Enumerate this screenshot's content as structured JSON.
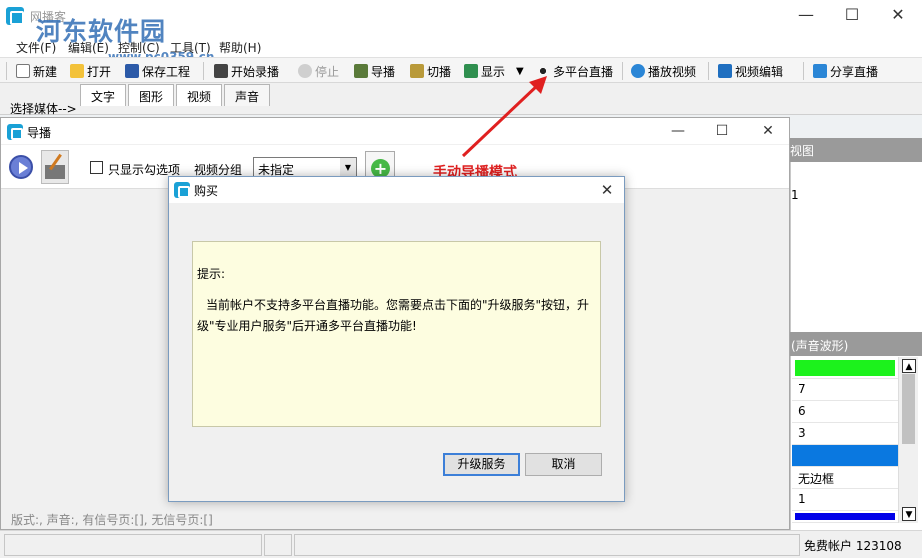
{
  "main_window": {
    "title": "网播客",
    "watermark_text": "河东软件园",
    "watermark_url": "www.pc0359.cn",
    "caption": {
      "minimize": "—",
      "maximize": "☐",
      "close": "✕"
    }
  },
  "menu": [
    "文件(F)",
    "编辑(E)",
    "控制(C)",
    "工具(T)",
    "帮助(H)"
  ],
  "toolbar": {
    "new": "新建",
    "open": "打开",
    "save": "保存工程",
    "start_record": "开始录播",
    "stop": "停止",
    "director": "导播",
    "switch": "切播",
    "display": "显示",
    "display_dropdown": "▼",
    "multi_live": "多平台直播",
    "play_video": "播放视频",
    "video_edit": "视频编辑",
    "share_live": "分享直播"
  },
  "media": {
    "select_label": "选择媒体-->",
    "tabs": [
      "文字",
      "图形",
      "视频",
      "声音"
    ]
  },
  "right_panel": {
    "header1": "视图",
    "value1": "1",
    "header2": "(声音波形)",
    "rows": [
      "",
      "7",
      "6",
      "3",
      "",
      "无边框",
      "1",
      ""
    ],
    "row_colors": {
      "green": "#1cf21c",
      "blue_sel": "#0a78e0",
      "blue_bar": "#0000e8"
    },
    "scroll_up": "▲",
    "scroll_down": "▼"
  },
  "director_window": {
    "title": "导播",
    "caption": {
      "minimize": "—",
      "maximize": "☐",
      "close": "✕"
    },
    "only_checked_label": "只显示勾选项",
    "video_group_label": "视频分组",
    "video_group_value": "未指定",
    "status_text": "版式:, 声音:, 有信号页:[], 无信号页:[]"
  },
  "annotation": {
    "text": "手动导播模式",
    "color": "#e02020"
  },
  "buy_dialog": {
    "title": "购买",
    "close": "✕",
    "hint_label": "提示:",
    "message": "当前帐户不支持多平台直播功能。您需要点击下面的\"升级服务\"按钮，升级\"专业用户服务\"后开通多平台直播功能!",
    "upgrade_button": "升级服务",
    "cancel_button": "取消"
  },
  "status_bar": {
    "account": "免费帐户 123108"
  }
}
